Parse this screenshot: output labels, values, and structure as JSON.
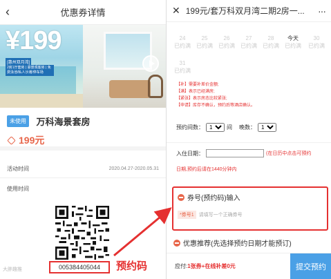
{
  "left": {
    "header": {
      "back_icon": "chevron-left-icon",
      "title": "优惠券详情"
    },
    "banner": {
      "price": "¥199",
      "tagline": "[惠州双月湾]",
      "desc": "2房1厅套房 | 豪景观客房 | 免费泳池/私人沙滩/停车场",
      "play_icon": "play-icon"
    },
    "coupon": {
      "status": "未使用",
      "name": "万科海景套房",
      "price": "199元",
      "tag_icon": "price-tag-icon"
    },
    "activity": {
      "label": "活动时间",
      "value": "2020.04.27-2020.05.31"
    },
    "usage": {
      "label": "使用时间"
    },
    "code": "005384405044",
    "watermark": "大胖趣推",
    "callout": "预约码"
  },
  "right": {
    "header": {
      "close_icon": "close-icon",
      "title": "199元/套万科双月湾二期2房一...",
      "more_icon": "more-icon"
    },
    "calendar": {
      "row1": [
        {
          "d": "24",
          "s": "已约满"
        },
        {
          "d": "25",
          "s": "已约满"
        },
        {
          "d": "26",
          "s": "已约满"
        },
        {
          "d": "27",
          "s": "已约满"
        },
        {
          "d": "28",
          "s": "已约满"
        },
        {
          "d": "今天",
          "s": "已约满"
        },
        {
          "d": "30",
          "s": "已约满"
        }
      ],
      "row2": [
        {
          "d": "31",
          "s": "已约满"
        }
      ]
    },
    "legend": [
      "【补】需要补差价金额;",
      "【满】表示已经满房;",
      "【紧张】表示房态比较紧张;",
      "【申请】库存不确认，预约后等酒店确认。"
    ],
    "booking": {
      "rooms_label": "预约间数：",
      "rooms_value": "1",
      "rooms_unit": "间",
      "nights_label": "晚数：",
      "nights_value": "1",
      "checkin_label": "入住日期：",
      "checkin_hint": "(在日历中点击可预约",
      "checkin_hint2": "日期,预约后请在1440分钟内"
    },
    "promo": {
      "title": "券号(预约码)输入",
      "badge": "*券号1",
      "placeholder": "请填写一个正确券号"
    },
    "recommend": "优惠推荐(先选择预约日期才能预订)",
    "footer": {
      "pay_label": "应付:",
      "pay_value": "1张券+在线补差0元",
      "submit": "提交预约"
    }
  }
}
